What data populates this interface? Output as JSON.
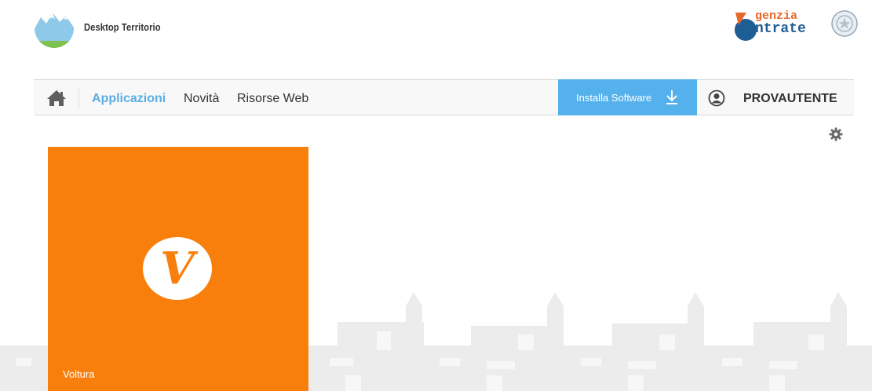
{
  "header": {
    "app_name": "Desktop Territorio",
    "agency_line1": "genzia",
    "agency_line2": "ntrate"
  },
  "nav": {
    "items": [
      {
        "label": "Applicazioni",
        "active": true
      },
      {
        "label": "Novità",
        "active": false
      },
      {
        "label": "Risorse Web",
        "active": false
      }
    ],
    "install_label": "Installa Software",
    "user_name": "PROVAUTENTE"
  },
  "tiles": [
    {
      "label": "Voltura",
      "letter": "V",
      "color": "#f97f0c"
    }
  ],
  "icons": {
    "home": "home-icon",
    "download": "download-arrow-icon",
    "user": "user-circle-icon",
    "settings": "gear-icon"
  },
  "colors": {
    "accent": "#55b1ec",
    "active_nav": "#5aaee3",
    "tile": "#f97f0c"
  }
}
